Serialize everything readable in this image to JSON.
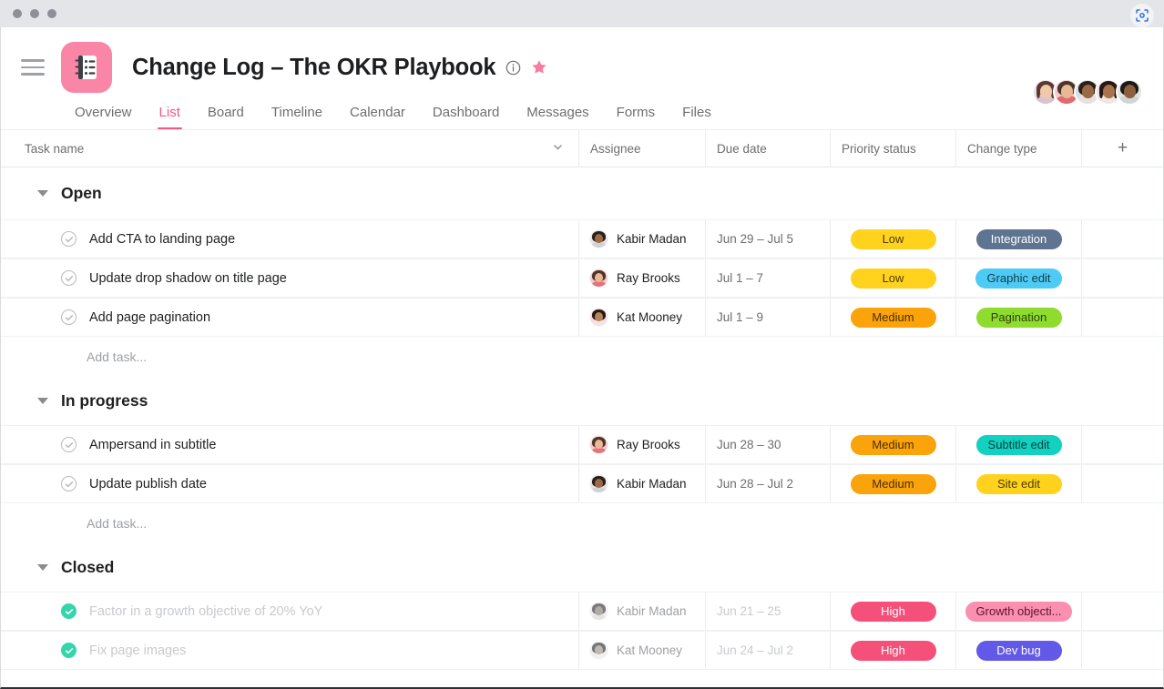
{
  "window": {
    "traffic_lights": [
      "close",
      "minimize",
      "maximize"
    ],
    "capture_icon": "screenshot-focus-icon"
  },
  "header": {
    "menu_icon": "hamburger-menu-icon",
    "project_icon": "notebook-list-icon",
    "title": "Change Log – The OKR Playbook",
    "info_icon": "info-circle-icon",
    "star_icon": "star-icon",
    "star_color": "#f87ca0",
    "accent_color": "#f2587f",
    "members": [
      {
        "name": "member-1",
        "bg": "#e9dff0",
        "hair": "#5b3a2c",
        "skin": "#f2c9a8",
        "shirt": "#d9c4cf"
      },
      {
        "name": "member-2",
        "bg": "#f6cdd2",
        "hair": "#4a352a",
        "skin": "#eab894",
        "shirt": "#e06a70"
      },
      {
        "name": "member-3",
        "bg": "#d7dfe2",
        "hair": "#2b2018",
        "skin": "#9a6a46",
        "shirt": "#e6e3dd"
      },
      {
        "name": "member-4",
        "bg": "#f7dde2",
        "hair": "#241a14",
        "skin": "#a9734c",
        "shirt": "#f0e6e3"
      },
      {
        "name": "member-5",
        "bg": "#dfe6e4",
        "hair": "#1f1713",
        "skin": "#8d5f3e",
        "shirt": "#cfd6d4"
      }
    ]
  },
  "tabs": [
    {
      "label": "Overview",
      "active": false
    },
    {
      "label": "List",
      "active": true
    },
    {
      "label": "Board",
      "active": false
    },
    {
      "label": "Timeline",
      "active": false
    },
    {
      "label": "Calendar",
      "active": false
    },
    {
      "label": "Dashboard",
      "active": false
    },
    {
      "label": "Messages",
      "active": false
    },
    {
      "label": "Forms",
      "active": false
    },
    {
      "label": "Files",
      "active": false
    }
  ],
  "table": {
    "columns": {
      "task_name": "Task name",
      "assignee": "Assignee",
      "due_date": "Due date",
      "priority": "Priority status",
      "change_type": "Change type",
      "add_column": "+"
    },
    "sort_chevron_icon": "chevron-down-icon",
    "add_task_label": "Add task...",
    "groups": [
      {
        "title": "Open",
        "collapsed": false,
        "rows": [
          {
            "task": "Add CTA to landing page",
            "completed": false,
            "assignee": "Kabir Madan",
            "avatar": {
              "bg": "#e8e3ec",
              "hair": "#2a1f18",
              "skin": "#9c6a45",
              "shirt": "#cfd3d6"
            },
            "due": "Jun 29 – Jul 5",
            "priority": {
              "label": "Low",
              "bg": "#ffd21e",
              "fg": "#4a3c00"
            },
            "change": {
              "label": "Integration",
              "bg": "#5f7490",
              "fg": "#ffffff"
            }
          },
          {
            "task": "Update drop shadow on title page",
            "completed": false,
            "assignee": "Ray Brooks",
            "avatar": {
              "bg": "#f6c9ce",
              "hair": "#4c3628",
              "skin": "#eab894",
              "shirt": "#e3737a"
            },
            "due": "Jul 1 – 7",
            "priority": {
              "label": "Low",
              "bg": "#ffd21e",
              "fg": "#4a3c00"
            },
            "change": {
              "label": "Graphic edit",
              "bg": "#4ecbf5",
              "fg": "#173a47"
            }
          },
          {
            "task": "Add page pagination",
            "completed": false,
            "assignee": "Kat Mooney",
            "avatar": {
              "bg": "#f7dde2",
              "hair": "#241a14",
              "skin": "#b9835c",
              "shirt": "#efe5e2"
            },
            "due": "Jul 1 – 9",
            "priority": {
              "label": "Medium",
              "bg": "#fba30a",
              "fg": "#4a2e00"
            },
            "change": {
              "label": "Pagination",
              "bg": "#8fdb2e",
              "fg": "#2b4406"
            }
          }
        ]
      },
      {
        "title": "In progress",
        "collapsed": false,
        "rows": [
          {
            "task": "Ampersand in subtitle",
            "completed": false,
            "assignee": "Ray Brooks",
            "avatar": {
              "bg": "#f6c9ce",
              "hair": "#4c3628",
              "skin": "#eab894",
              "shirt": "#e3737a"
            },
            "due": "Jun 28 – 30",
            "priority": {
              "label": "Medium",
              "bg": "#fba30a",
              "fg": "#4a2e00"
            },
            "change": {
              "label": "Subtitle edit",
              "bg": "#12d1c0",
              "fg": "#05423d"
            }
          },
          {
            "task": "Update publish date",
            "completed": false,
            "assignee": "Kabir Madan",
            "avatar": {
              "bg": "#e8e3ec",
              "hair": "#2a1f18",
              "skin": "#9c6a45",
              "shirt": "#cfd3d6"
            },
            "due": "Jun 28 – Jul 2",
            "priority": {
              "label": "Medium",
              "bg": "#fba30a",
              "fg": "#4a2e00"
            },
            "change": {
              "label": "Site edit",
              "bg": "#ffd21e",
              "fg": "#4a3c00"
            }
          }
        ]
      },
      {
        "title": "Closed",
        "collapsed": false,
        "rows": [
          {
            "task": "Factor in a growth objective of 20% YoY",
            "completed": true,
            "assignee": "Kabir Madan",
            "avatar": {
              "bg": "#e8e3ec",
              "hair": "#2a1f18",
              "skin": "#9c6a45",
              "shirt": "#cfd3d6"
            },
            "due": "Jun 21 – 25",
            "priority": {
              "label": "High",
              "bg": "#f4507a",
              "fg": "#ffffff"
            },
            "change": {
              "label": "Growth objecti...",
              "bg": "#fb8fb0",
              "fg": "#5c1330"
            }
          },
          {
            "task": "Fix page images",
            "completed": true,
            "assignee": "Kat Mooney",
            "avatar": {
              "bg": "#f7dde2",
              "hair": "#241a14",
              "skin": "#b9835c",
              "shirt": "#efe5e2"
            },
            "due": "Jun 24 – Jul 2",
            "priority": {
              "label": "High",
              "bg": "#f4507a",
              "fg": "#ffffff"
            },
            "change": {
              "label": "Dev bug",
              "bg": "#6359e9",
              "fg": "#ffffff"
            }
          }
        ]
      }
    ]
  }
}
